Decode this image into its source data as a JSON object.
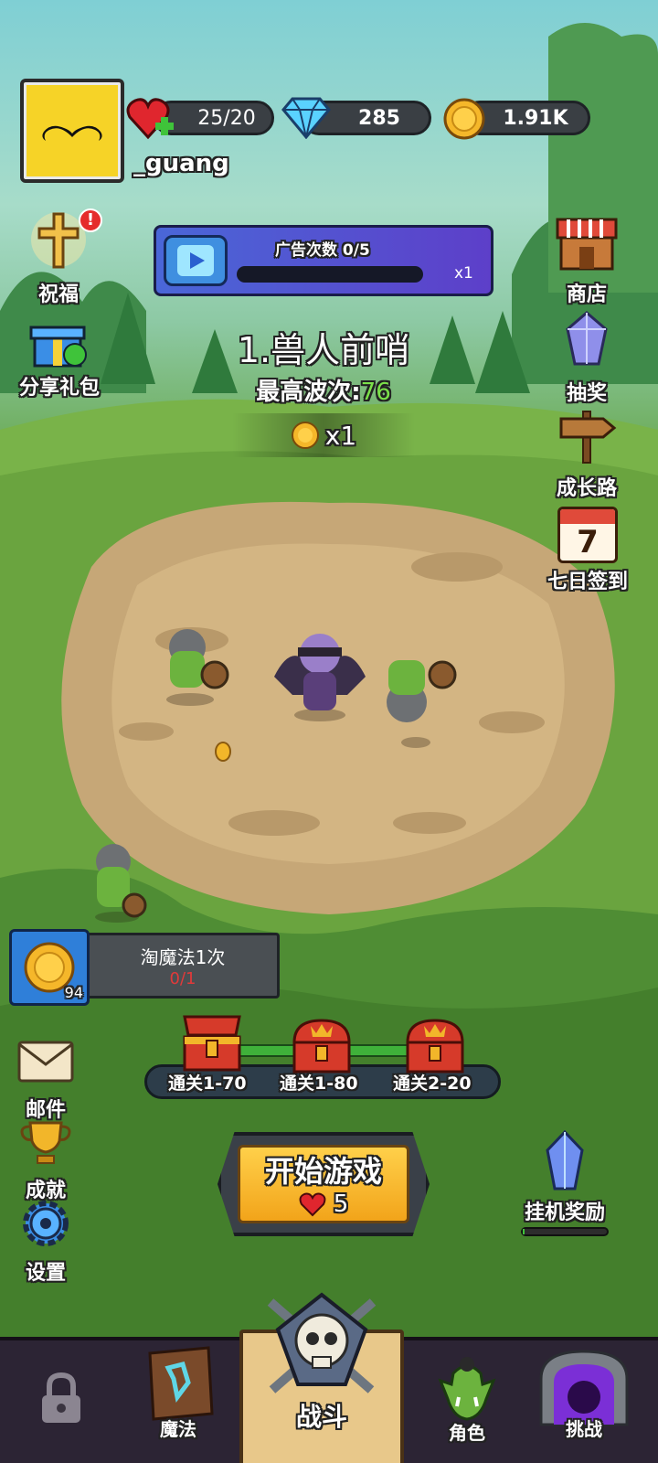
{
  "player": {
    "name": "_guang"
  },
  "resources": {
    "hearts": "25/20",
    "gems": "285",
    "coins": "1.91K"
  },
  "left_menu": [
    {
      "label": "祝福",
      "icon": "cross-blessing-icon",
      "badge": "!"
    },
    {
      "label": "分享礼包",
      "icon": "gift-share-icon"
    },
    {
      "label": "邮件",
      "icon": "mail-envelope-icon"
    },
    {
      "label": "成就",
      "icon": "trophy-icon"
    },
    {
      "label": "设置",
      "icon": "gear-icon"
    }
  ],
  "right_menu": [
    {
      "label": "商店",
      "icon": "shop-stall-icon"
    },
    {
      "label": "抽奖",
      "icon": "crystal-lottery-icon"
    },
    {
      "label": "成长路",
      "icon": "signpost-icon"
    },
    {
      "label": "七日签到",
      "icon": "calendar-icon",
      "day": "7"
    }
  ],
  "ad": {
    "title": "广告次数 0/5",
    "multiplier": "x1",
    "progress": 0
  },
  "stage": {
    "name": "1.兽人前哨",
    "best_label": "最高波次:",
    "best_value": "76",
    "coin_mult": "x1"
  },
  "quest": {
    "title": "淘魔法1次",
    "progress": "0/1",
    "count": "94"
  },
  "chests": [
    {
      "label": "通关1-70",
      "state": "open"
    },
    {
      "label": "通关1-80",
      "state": "closed"
    },
    {
      "label": "通关2-20",
      "state": "closed"
    }
  ],
  "start": {
    "label": "开始游戏",
    "cost": "5"
  },
  "idle": {
    "label": "挂机奖励",
    "progress": 0.02
  },
  "nav": [
    {
      "label": "",
      "icon": "lock-icon"
    },
    {
      "label": "魔法",
      "icon": "spellbook-icon"
    },
    {
      "label": "战斗",
      "icon": "skull-swords-icon"
    },
    {
      "label": "角色",
      "icon": "orc-head-icon"
    },
    {
      "label": "挑战",
      "icon": "portal-icon"
    }
  ],
  "colors": {
    "best_value": "#7be04a",
    "quest_progress": "#e03a3a",
    "start_button": "#f5b728",
    "panel_dark": "#3a3f44"
  }
}
